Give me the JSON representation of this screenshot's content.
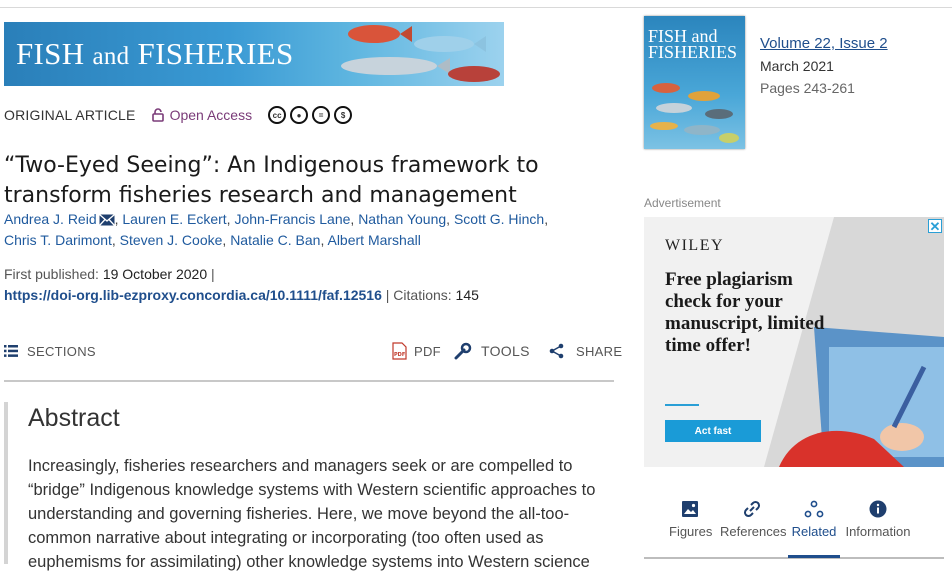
{
  "journal": {
    "title_part1": "FISH",
    "title_and": "and",
    "title_part2": "FISHERIES"
  },
  "article": {
    "type": "ORIGINAL ARTICLE",
    "open_access": "Open Access",
    "title": "“Two-Eyed Seeing”: An Indigenous framework to transform fisheries research and management",
    "authors": [
      "Andrea J. Reid",
      "Lauren E. Eckert",
      "John-Francis Lane",
      "Nathan Young",
      "Scott G. Hinch",
      "Chris T. Darimont",
      "Steven J. Cooke",
      "Natalie C. Ban",
      "Albert Marshall"
    ],
    "first_published_label": "First published:",
    "first_published": "19 October 2020",
    "doi": "https://doi-org.lib-ezproxy.concordia.ca/10.1111/faf.12516",
    "citations_label": "Citations:",
    "citations": "145"
  },
  "toolbar": {
    "sections": "SECTIONS",
    "pdf": "PDF",
    "tools": "TOOLS",
    "share": "SHARE"
  },
  "abstract": {
    "heading": "Abstract",
    "text": "Increasingly, fisheries researchers and managers seek or are compelled to “bridge” Indigenous knowledge systems with Western scientific approaches to understanding and governing fisheries. Here, we move beyond the all-too-common narrative about integrating or incorporating (too often used as euphemisms for assimilating) other knowledge systems into Western science"
  },
  "cover": {
    "line1": "FISH and",
    "line2": "FISHERIES"
  },
  "issue": {
    "volume": "Volume 22, Issue 2",
    "date": "March 2021",
    "pages": "Pages 243-261"
  },
  "advertisement": {
    "label": "Advertisement",
    "brand": "WILEY",
    "headline": "Free plagiarism check for your manuscript, limited time offer!",
    "cta": "Act fast",
    "close": "✕"
  },
  "tabs": [
    {
      "label": "Figures",
      "icon": "image-icon"
    },
    {
      "label": "References",
      "icon": "link-icon"
    },
    {
      "label": "Related",
      "icon": "related-icon",
      "active": true
    },
    {
      "label": "Information",
      "icon": "info-icon"
    }
  ],
  "colors": {
    "link": "#1f5a9e",
    "doi": "#1f4e8c",
    "open_access": "#7a3b78",
    "ad_button": "#1a9bd7"
  }
}
